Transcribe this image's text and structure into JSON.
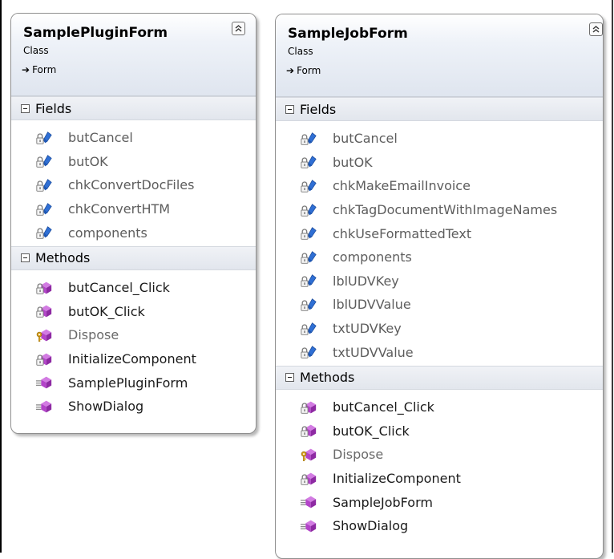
{
  "colors": {
    "field_icon_blue": "#2f6fd4",
    "method_icon_purple": "#b343c9",
    "lock_gray": "#7a7a7a",
    "key_gold": "#d8a11e",
    "header_gradient_end": "#dfe5ef"
  },
  "classes": [
    {
      "name": "SamplePluginForm",
      "stereotype": "Class",
      "base": "Form",
      "fields_label": "Fields",
      "methods_label": "Methods",
      "fields": [
        {
          "name": "butCancel",
          "icon": "private-field-icon"
        },
        {
          "name": "butOK",
          "icon": "private-field-icon"
        },
        {
          "name": "chkConvertDocFiles",
          "icon": "private-field-icon"
        },
        {
          "name": "chkConvertHTM",
          "icon": "private-field-icon"
        },
        {
          "name": "components",
          "icon": "private-field-icon"
        }
      ],
      "methods": [
        {
          "name": "butCancel_Click",
          "icon": "private-method-icon"
        },
        {
          "name": "butOK_Click",
          "icon": "private-method-icon"
        },
        {
          "name": "Dispose",
          "icon": "protected-method-icon"
        },
        {
          "name": "InitializeComponent",
          "icon": "private-method-icon"
        },
        {
          "name": "SamplePluginForm",
          "icon": "public-method-icon"
        },
        {
          "name": "ShowDialog",
          "icon": "public-method-icon"
        }
      ]
    },
    {
      "name": "SampleJobForm",
      "stereotype": "Class",
      "base": "Form",
      "fields_label": "Fields",
      "methods_label": "Methods",
      "fields": [
        {
          "name": "butCancel",
          "icon": "private-field-icon"
        },
        {
          "name": "butOK",
          "icon": "private-field-icon"
        },
        {
          "name": "chkMakeEmailInvoice",
          "icon": "private-field-icon"
        },
        {
          "name": "chkTagDocumentWithImageNames",
          "icon": "private-field-icon"
        },
        {
          "name": "chkUseFormattedText",
          "icon": "private-field-icon"
        },
        {
          "name": "components",
          "icon": "private-field-icon"
        },
        {
          "name": "lblUDVKey",
          "icon": "private-field-icon"
        },
        {
          "name": "lblUDVValue",
          "icon": "private-field-icon"
        },
        {
          "name": "txtUDVKey",
          "icon": "private-field-icon"
        },
        {
          "name": "txtUDVValue",
          "icon": "private-field-icon"
        }
      ],
      "methods": [
        {
          "name": "butCancel_Click",
          "icon": "private-method-icon"
        },
        {
          "name": "butOK_Click",
          "icon": "private-method-icon"
        },
        {
          "name": "Dispose",
          "icon": "protected-method-icon"
        },
        {
          "name": "InitializeComponent",
          "icon": "private-method-icon"
        },
        {
          "name": "SampleJobForm",
          "icon": "public-method-icon"
        },
        {
          "name": "ShowDialog",
          "icon": "public-method-icon"
        }
      ]
    }
  ]
}
